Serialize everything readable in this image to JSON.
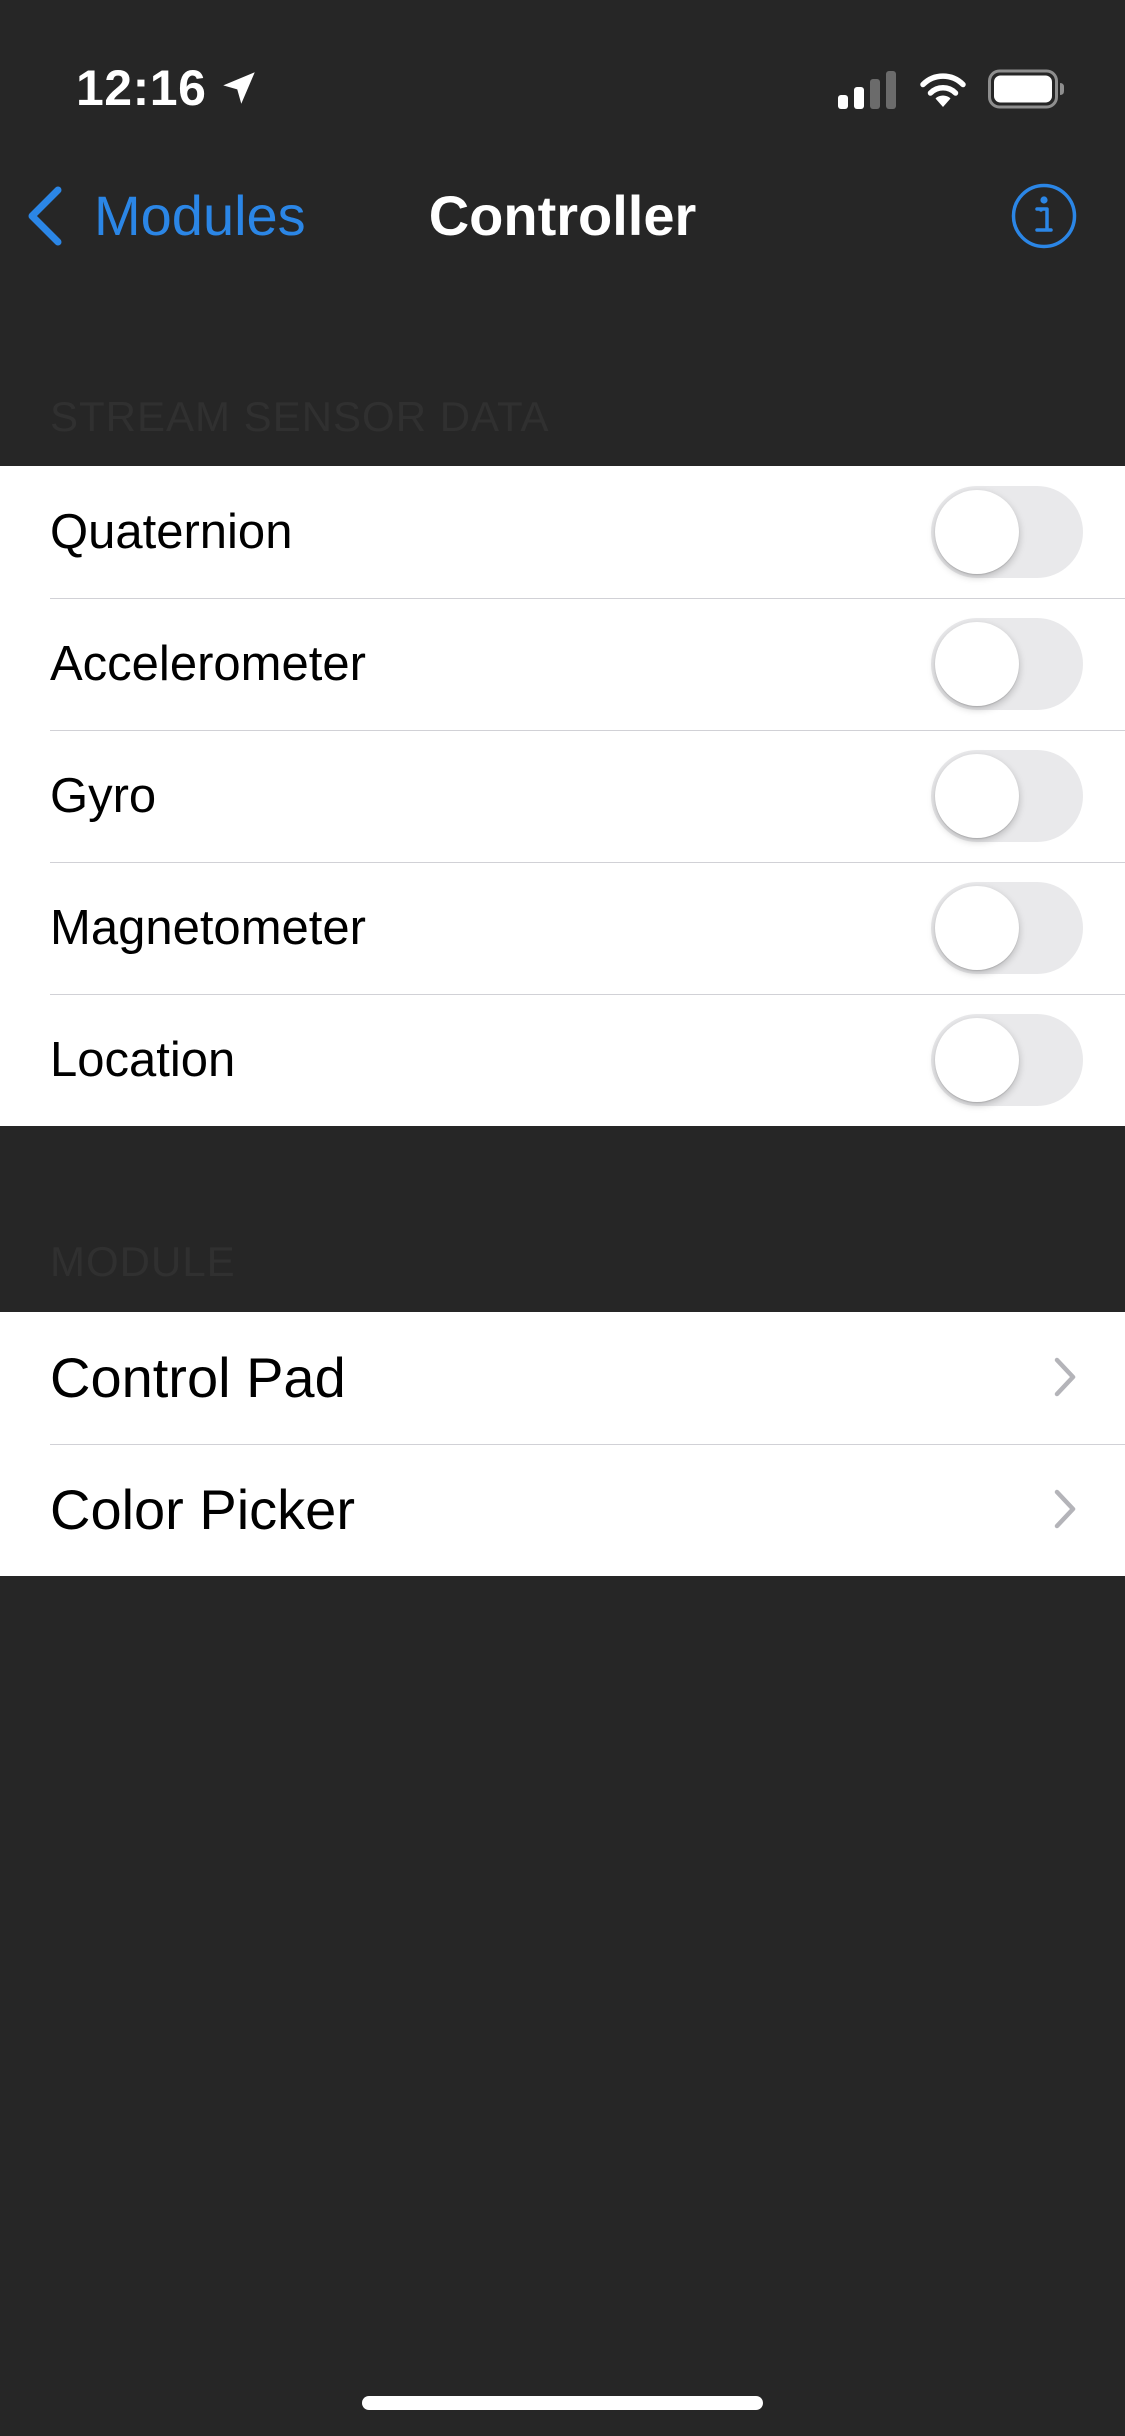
{
  "status_bar": {
    "time": "12:16",
    "location_icon": "location-arrow-icon",
    "signal_icon": "cellular-signal-icon",
    "wifi_icon": "wifi-icon",
    "battery_icon": "battery-icon"
  },
  "nav": {
    "back_label": "Modules",
    "back_icon": "chevron-left-icon",
    "title": "Controller",
    "info_icon": "info-circle-icon"
  },
  "sections": {
    "stream": {
      "header": "STREAM SENSOR DATA",
      "rows": [
        {
          "label": "Quaternion",
          "enabled": false
        },
        {
          "label": "Accelerometer",
          "enabled": false
        },
        {
          "label": "Gyro",
          "enabled": false
        },
        {
          "label": "Magnetometer",
          "enabled": false
        },
        {
          "label": "Location",
          "enabled": false
        }
      ]
    },
    "module": {
      "header": "MODULE",
      "rows": [
        {
          "label": "Control Pad",
          "icon": "chevron-right-icon"
        },
        {
          "label": "Color Picker",
          "icon": "chevron-right-icon"
        }
      ]
    }
  },
  "colors": {
    "background": "#262626",
    "accent": "#2b86e6",
    "cell_background": "#ffffff",
    "toggle_off": "#e9e9eb"
  }
}
